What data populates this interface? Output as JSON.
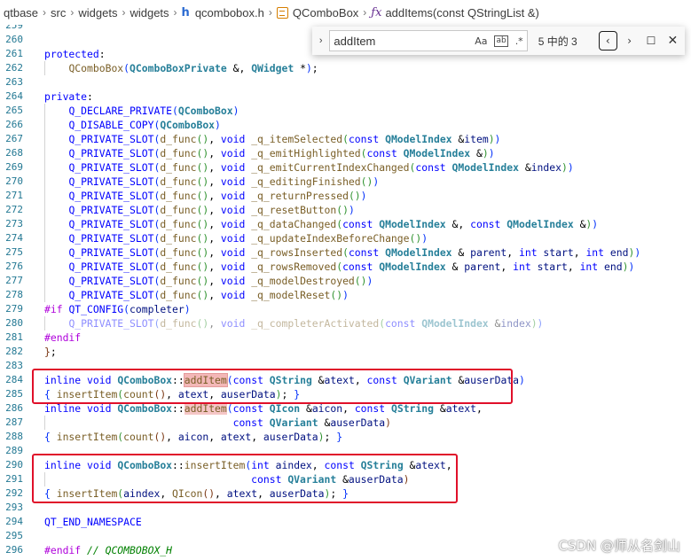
{
  "breadcrumb": {
    "items": [
      "qtbase",
      "src",
      "widgets",
      "widgets",
      "qcombobox.h",
      "QComboBox",
      "addItems(const QStringList &)"
    ],
    "separator": "›"
  },
  "find_widget": {
    "query": "addItem",
    "toggle_icon": "chevron-right-icon",
    "match_case_label": "Aa",
    "whole_word_label": "ab",
    "regex_label": ".*",
    "result_count": "5 中的 3",
    "prev_glyph": "‹",
    "next_glyph": "›",
    "selection_glyph": "☐",
    "close_glyph": "✕"
  },
  "line_numbers": [
    "259",
    "260",
    "261",
    "262",
    "263",
    "264",
    "265",
    "266",
    "267",
    "268",
    "269",
    "270",
    "271",
    "272",
    "273",
    "274",
    "275",
    "276",
    "277",
    "278",
    "279",
    "280",
    "281",
    "282",
    "283",
    "284",
    "285",
    "286",
    "287",
    "288",
    "289",
    "290",
    "291",
    "292",
    "293",
    "294",
    "295",
    "296"
  ],
  "code_lines": [
    "",
    "",
    "protected:",
    "    QComboBox(QComboBoxPrivate &, QWidget *);",
    "",
    "private:",
    "    Q_DECLARE_PRIVATE(QComboBox)",
    "    Q_DISABLE_COPY(QComboBox)",
    "    Q_PRIVATE_SLOT(d_func(), void _q_itemSelected(const QModelIndex &item))",
    "    Q_PRIVATE_SLOT(d_func(), void _q_emitHighlighted(const QModelIndex &))",
    "    Q_PRIVATE_SLOT(d_func(), void _q_emitCurrentIndexChanged(const QModelIndex &index))",
    "    Q_PRIVATE_SLOT(d_func(), void _q_editingFinished())",
    "    Q_PRIVATE_SLOT(d_func(), void _q_returnPressed())",
    "    Q_PRIVATE_SLOT(d_func(), void _q_resetButton())",
    "    Q_PRIVATE_SLOT(d_func(), void _q_dataChanged(const QModelIndex &, const QModelIndex &))",
    "    Q_PRIVATE_SLOT(d_func(), void _q_updateIndexBeforeChange())",
    "    Q_PRIVATE_SLOT(d_func(), void _q_rowsInserted(const QModelIndex & parent, int start, int end))",
    "    Q_PRIVATE_SLOT(d_func(), void _q_rowsRemoved(const QModelIndex & parent, int start, int end))",
    "    Q_PRIVATE_SLOT(d_func(), void _q_modelDestroyed())",
    "    Q_PRIVATE_SLOT(d_func(), void _q_modelReset())",
    "#if QT_CONFIG(completer)",
    "    Q_PRIVATE_SLOT(d_func(), void _q_completerActivated(const QModelIndex &index))",
    "#endif",
    "};",
    "",
    "inline void QComboBox::addItem(const QString &atext, const QVariant &auserData)",
    "{ insertItem(count(), atext, auserData); }",
    "inline void QComboBox::addItem(const QIcon &aicon, const QString &atext,",
    "                               const QVariant &auserData)",
    "{ insertItem(count(), aicon, atext, auserData); }",
    "",
    "inline void QComboBox::insertItem(int aindex, const QString &atext,",
    "                                  const QVariant &auserData)",
    "{ insertItem(aindex, QIcon(), atext, auserData); }",
    "",
    "QT_END_NAMESPACE",
    "",
    "#endif // QCOMBOBOX_H"
  ],
  "watermark": "CSDN @师从名剑山",
  "colors": {
    "keyword": "#0000ff",
    "control_keyword": "#af00db",
    "function": "#795e26",
    "type": "#267f99",
    "line_number": "#237893",
    "comment": "#008000",
    "highlight_box": "#e0102a",
    "match_background": "#f5c6c6"
  }
}
